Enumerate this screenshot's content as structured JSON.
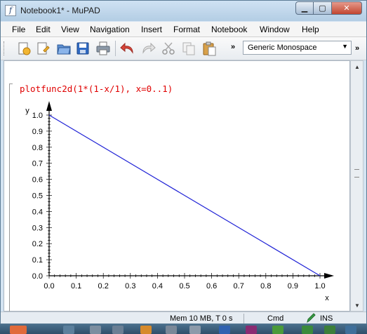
{
  "window": {
    "title": "Notebook1* - MuPAD"
  },
  "menubar": {
    "items": [
      "File",
      "Edit",
      "View",
      "Navigation",
      "Insert",
      "Format",
      "Notebook",
      "Window",
      "Help"
    ]
  },
  "toolbar": {
    "font_selector": "Generic Monospace",
    "overflow": "»"
  },
  "notebook": {
    "command": "plotfunc2d(1*(1-x/1), x=0..1)"
  },
  "chart_data": {
    "type": "line",
    "xlabel": "x",
    "ylabel": "y",
    "xlim": [
      0,
      1
    ],
    "ylim": [
      0,
      1
    ],
    "x_ticks": [
      "0.0",
      "0.1",
      "0.2",
      "0.3",
      "0.4",
      "0.5",
      "0.6",
      "0.7",
      "0.8",
      "0.9",
      "1.0"
    ],
    "y_ticks": [
      "0.0",
      "0.1",
      "0.2",
      "0.3",
      "0.4",
      "0.5",
      "0.6",
      "0.7",
      "0.8",
      "0.9",
      "1.0"
    ],
    "series": [
      {
        "x": [
          0,
          1
        ],
        "y": [
          1,
          0
        ],
        "color": "#1f22d6"
      }
    ],
    "grid": false
  },
  "statusbar": {
    "memory": "Mem 10 MB, T 0 s",
    "mode": "Cmd",
    "insert": "INS"
  },
  "colors": {
    "command": "#e00000",
    "plot_line": "#1f22d6",
    "accent": "#b3cde4"
  }
}
